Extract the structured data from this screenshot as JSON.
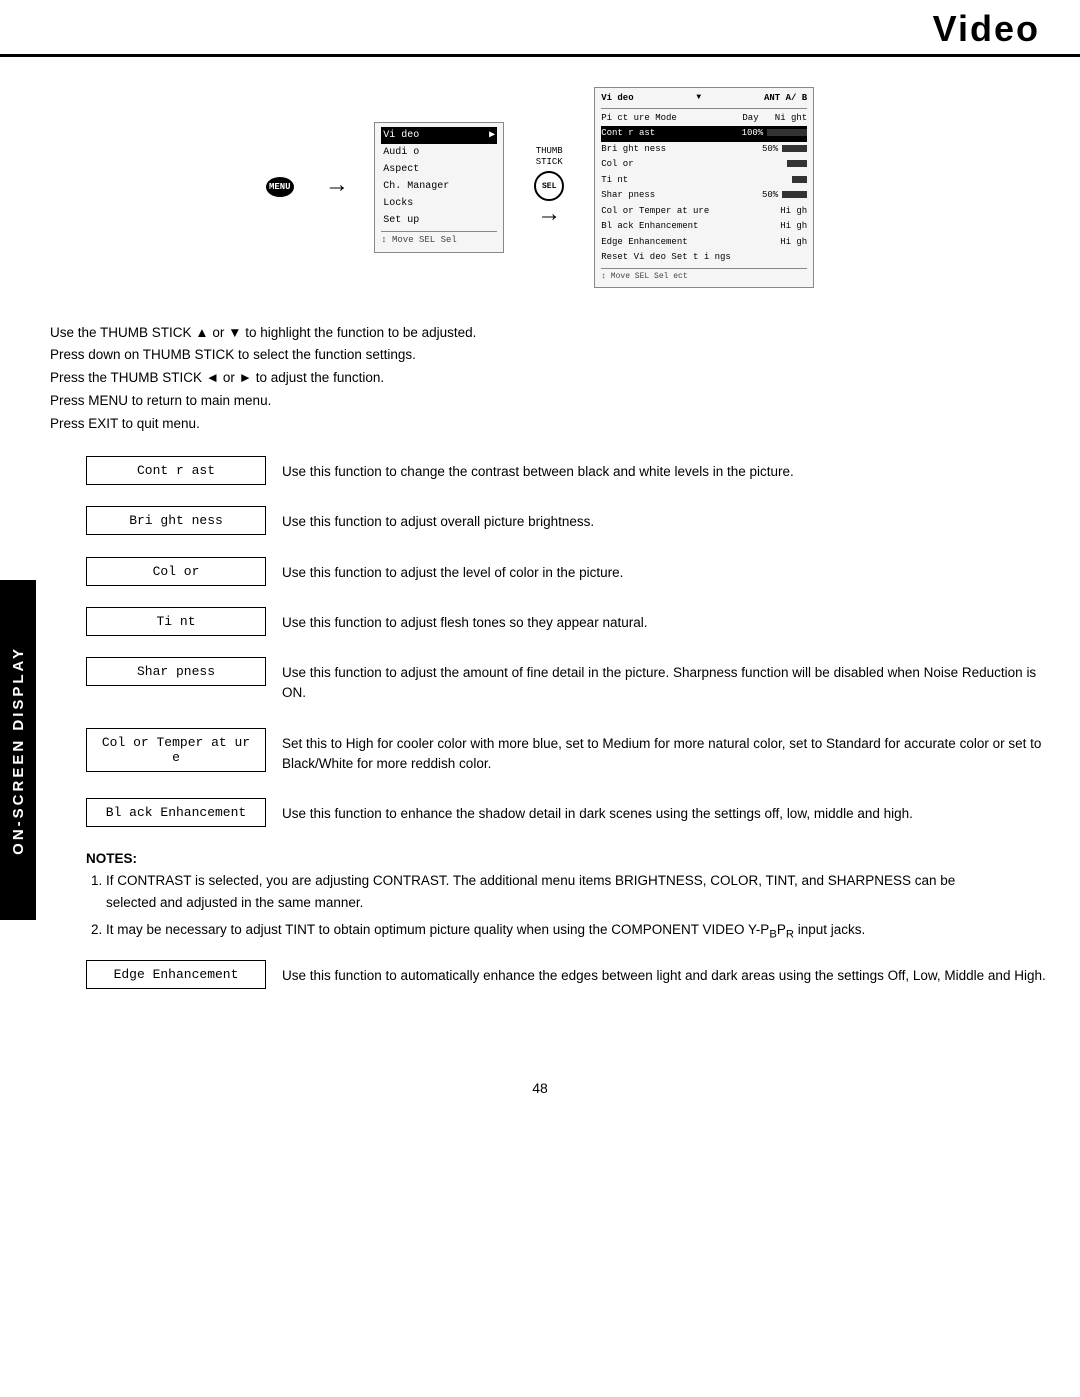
{
  "header": {
    "title": "Video"
  },
  "sideLabel": "ON-SCREEN DISPLAY",
  "diagram": {
    "menu1": {
      "title": "Video",
      "titleArrow": "▶",
      "items": [
        "Audio",
        "Aspect",
        "Ch. Manager",
        "Locks",
        "Set up"
      ],
      "footer": "↕ Move  SEL  Sel"
    },
    "menu2": {
      "header_left": "Video",
      "header_right": "ANT A/B",
      "rows": [
        {
          "label": "Picture Mode",
          "value": "Day    Night"
        },
        {
          "label": "Contrast",
          "value": "100%",
          "bar": 90
        },
        {
          "label": "Brightness",
          "value": "50%",
          "bar": 50
        },
        {
          "label": "Color",
          "value": "",
          "bar": 40
        },
        {
          "label": "Tint",
          "value": "",
          "bar": 30
        },
        {
          "label": "Sharpness",
          "value": "50%",
          "bar": 50
        },
        {
          "label": "Color Temperature",
          "value": "High"
        },
        {
          "label": "Black Enhancement",
          "value": "High"
        },
        {
          "label": "Edge Enhancement",
          "value": "High"
        },
        {
          "label": "Reset Video Settings",
          "value": ""
        }
      ],
      "footer": "↕ Move  SEL  Select"
    },
    "thumbLabel": "THUMB\nSTICK",
    "arrow1": "→",
    "arrow2": "→"
  },
  "instructions": [
    "Use the THUMB STICK ▲ or ▼ to highlight the function to be adjusted.",
    "Press down on THUMB STICK to select the function settings.",
    "Press the THUMB STICK ◄ or ► to adjust the function.",
    "Press MENU to return to main menu.",
    "Press EXIT to quit menu."
  ],
  "functions": [
    {
      "label": "Contrast",
      "description": "Use this function to change the contrast between black and white levels in the picture."
    },
    {
      "label": "Brightness",
      "description": "Use this function to adjust overall picture brightness."
    },
    {
      "label": "Color",
      "description": "Use this function to adjust the level of color in the picture."
    },
    {
      "label": "Tint",
      "description": "Use this function to adjust flesh tones so they appear natural."
    },
    {
      "label": "Sharpness",
      "description": "Use this function to adjust the amount of fine detail in the picture.  Sharpness function will be disabled when Noise Reduction is ON."
    },
    {
      "label": "Color  Temperature",
      "description": "Set this to High for cooler color with more blue, set to Medium for more natural color, set to Standard for accurate color or set to Black/White for more reddish color."
    },
    {
      "label": "Black  Enhancement",
      "description": "Use this function to enhance the shadow detail in dark scenes using the settings off, low, middle and high."
    }
  ],
  "notes": {
    "label": "NOTES:",
    "items": [
      "If CONTRAST is selected, you are adjusting CONTRAST.  The additional menu items BRIGHTNESS, COLOR, TINT, and SHARPNESS can be selected and adjusted in the same manner.",
      "It may be necessary to adjust TINT to obtain optimum picture quality when using the COMPONENT VIDEO Y-P_B_P_R input jacks."
    ]
  },
  "extraFunction": {
    "label": "Edge  Enhancement",
    "description": "Use this function to automatically enhance the edges between light and dark areas using the settings Off, Low, Middle and High."
  },
  "pageNumber": "48",
  "menuIcon": "MENU",
  "selectIcon": "SELECT"
}
